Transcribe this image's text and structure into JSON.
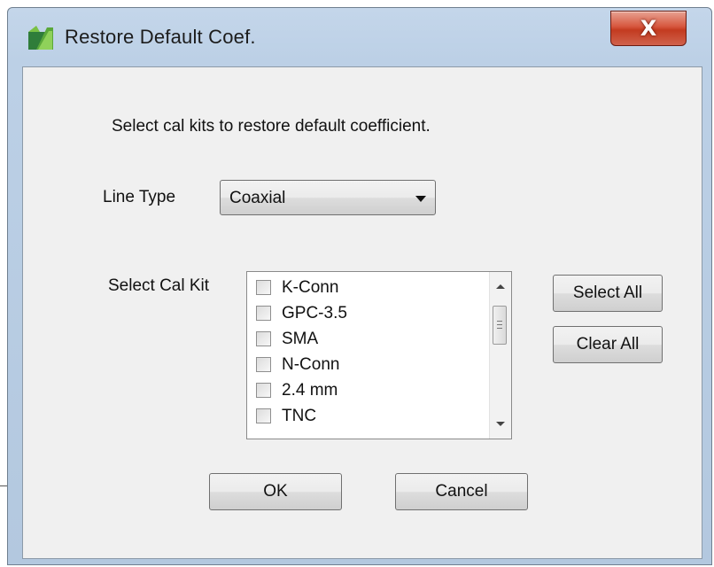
{
  "window": {
    "title": "Restore Default Coef.",
    "close_label": "X",
    "icon": "app-logo-icon"
  },
  "dialog": {
    "instruction": "Select cal kits to restore default coefficient.",
    "line_type": {
      "label": "Line Type",
      "selected": "Coaxial"
    },
    "cal_kit": {
      "label": "Select Cal Kit",
      "items": [
        {
          "label": "K-Conn",
          "checked": false
        },
        {
          "label": "GPC-3.5",
          "checked": false
        },
        {
          "label": "SMA",
          "checked": false
        },
        {
          "label": "N-Conn",
          "checked": false
        },
        {
          "label": "2.4 mm",
          "checked": false
        },
        {
          "label": "TNC",
          "checked": false
        }
      ]
    },
    "buttons": {
      "select_all": "Select All",
      "clear_all": "Clear All",
      "ok": "OK",
      "cancel": "Cancel"
    }
  },
  "colors": {
    "close_button": "#c33b20",
    "frame": "#bcd0e6",
    "client_bg": "#f0f0f0"
  }
}
